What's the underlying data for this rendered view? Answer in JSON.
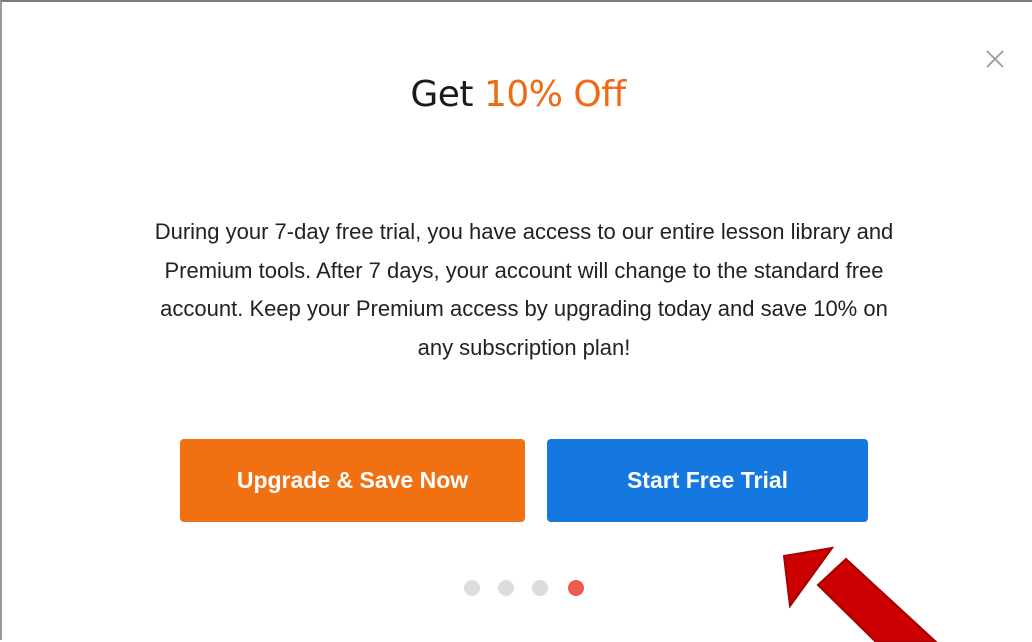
{
  "modal": {
    "close_glyph": "×",
    "title_prefix": "Get ",
    "title_highlight": "10% Off",
    "body_line1": "During your 7-day free trial, you have access to our entire lesson library and",
    "body_line2": "Premium tools. After 7 days, your account will change to the standard free",
    "body_line3": "account. Keep your Premium access by upgrading today and save 10% on",
    "body_line4": "any subscription plan!",
    "upgrade_button": "Upgrade & Save Now",
    "trial_button": "Start Free Trial",
    "pagination": {
      "total": 4,
      "active_index": 4
    }
  },
  "colors": {
    "accent_orange": "#ee6a14",
    "button_orange": "#f07012",
    "button_blue": "#1478e0",
    "dot_inactive": "#dcdcdc",
    "dot_active": "#ee5a4f",
    "annotation_arrow": "#cc0000"
  },
  "icons": {
    "close": "close-icon",
    "annotation": "red-arrow-annotation"
  }
}
